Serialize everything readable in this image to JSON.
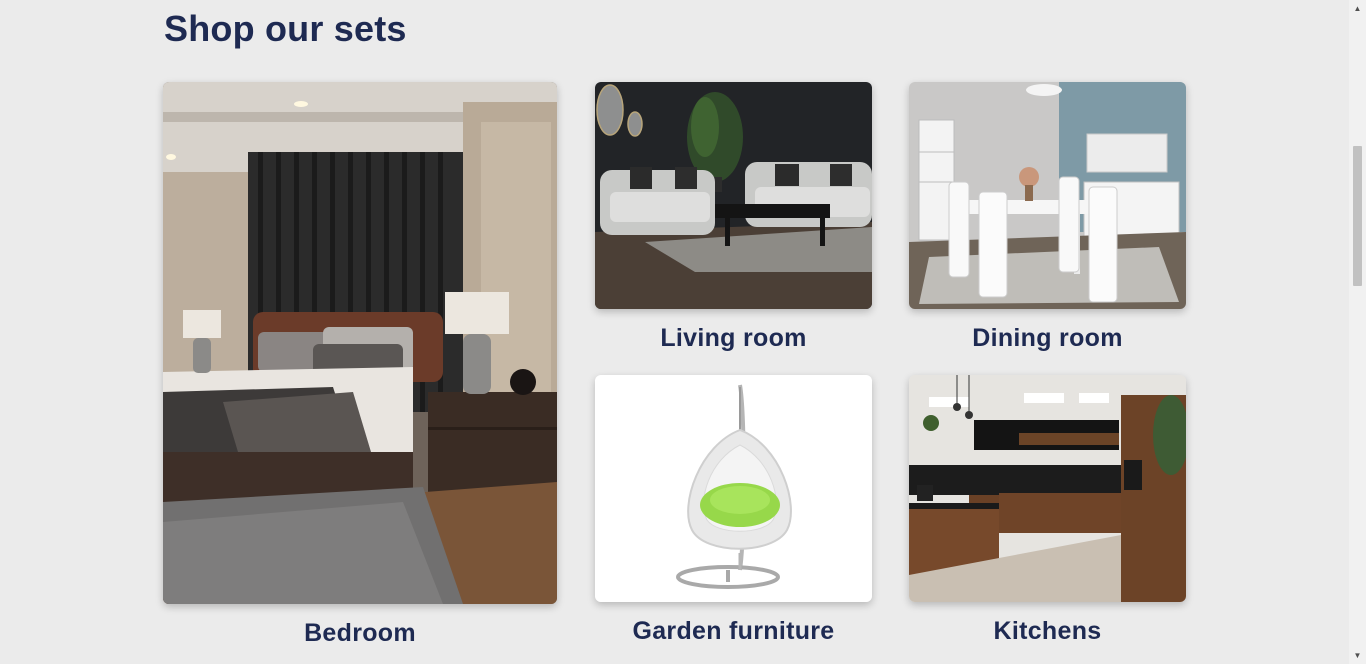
{
  "section": {
    "title": "Shop our sets"
  },
  "cards": [
    {
      "label": "Bedroom",
      "image": "bedroom-photo"
    },
    {
      "label": "Living room",
      "image": "living-room-photo"
    },
    {
      "label": "Dining room",
      "image": "dining-room-photo"
    },
    {
      "label": "Garden furniture",
      "image": "garden-hanging-chair-photo"
    },
    {
      "label": "Kitchens",
      "image": "kitchen-photo"
    }
  ],
  "colors": {
    "background": "#ebebeb",
    "heading": "#1e2a52"
  }
}
